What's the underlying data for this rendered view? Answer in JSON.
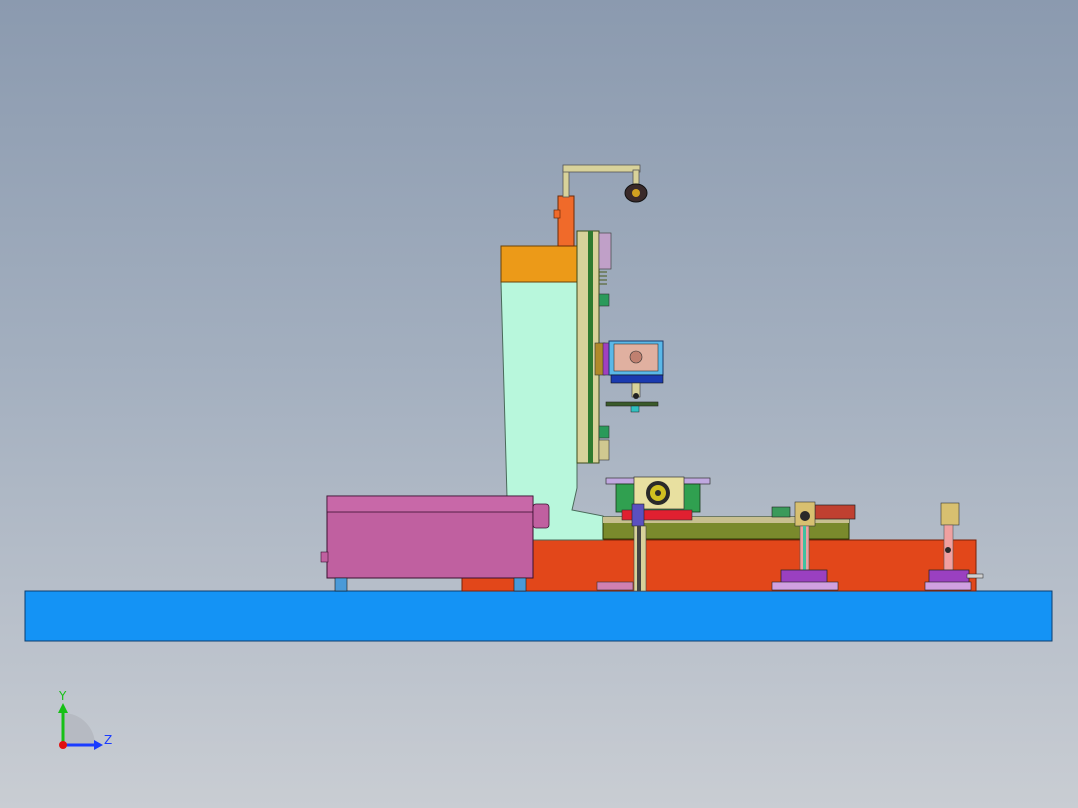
{
  "viewport": {
    "view": "side elevation",
    "colors": {
      "background_top": "#8b9aaf",
      "background_bottom": "#c9cdd3",
      "base_plate": "#1493f5",
      "bed": "#e2471a",
      "column": "#b8f7dc",
      "column_cap": "#ec9a18",
      "camera_arm": "#d8d29a",
      "cylinder": "#f06a2a",
      "enclosure": "#c060a0",
      "slide_rail": "#7a8a2c",
      "fixture_block": "#5ab8e8"
    }
  },
  "triad": {
    "x_axis_label": "Y",
    "z_axis_label": "Z",
    "y_color": "#16c016",
    "z_color": "#1a3cff",
    "origin_color": "#e01010",
    "icon": "coordinate-triad-icon"
  }
}
